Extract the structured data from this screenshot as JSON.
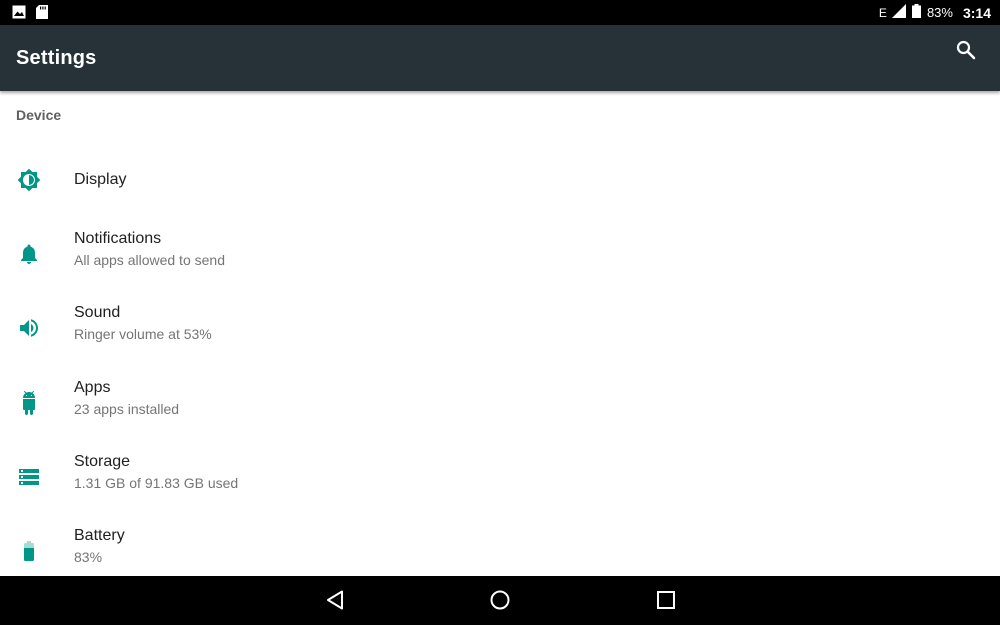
{
  "status_bar": {
    "network": "E",
    "battery": "83%",
    "time": "3:14",
    "left_icons": [
      "image-icon",
      "sd-card-icon"
    ]
  },
  "app_bar": {
    "title": "Settings",
    "search_icon": "search-icon"
  },
  "section": {
    "header": "Device",
    "items": [
      {
        "id": "display",
        "title": "Display",
        "summary": "",
        "icon": "brightness-icon"
      },
      {
        "id": "notifications",
        "title": "Notifications",
        "summary": "All apps allowed to send",
        "icon": "bell-icon"
      },
      {
        "id": "sound",
        "title": "Sound",
        "summary": "Ringer volume at 53%",
        "icon": "volume-icon"
      },
      {
        "id": "apps",
        "title": "Apps",
        "summary": "23 apps installed",
        "icon": "android-icon"
      },
      {
        "id": "storage",
        "title": "Storage",
        "summary": "1.31 GB of 91.83 GB used",
        "icon": "storage-icon"
      },
      {
        "id": "battery",
        "title": "Battery",
        "summary": "83%",
        "icon": "battery-icon"
      }
    ]
  },
  "nav_bar": {
    "buttons": [
      "back-icon",
      "home-icon",
      "recents-icon"
    ]
  },
  "colors": {
    "accent": "#009688",
    "app_bar": "#263238",
    "status_bar": "#000000",
    "nav_bar": "#000000"
  }
}
